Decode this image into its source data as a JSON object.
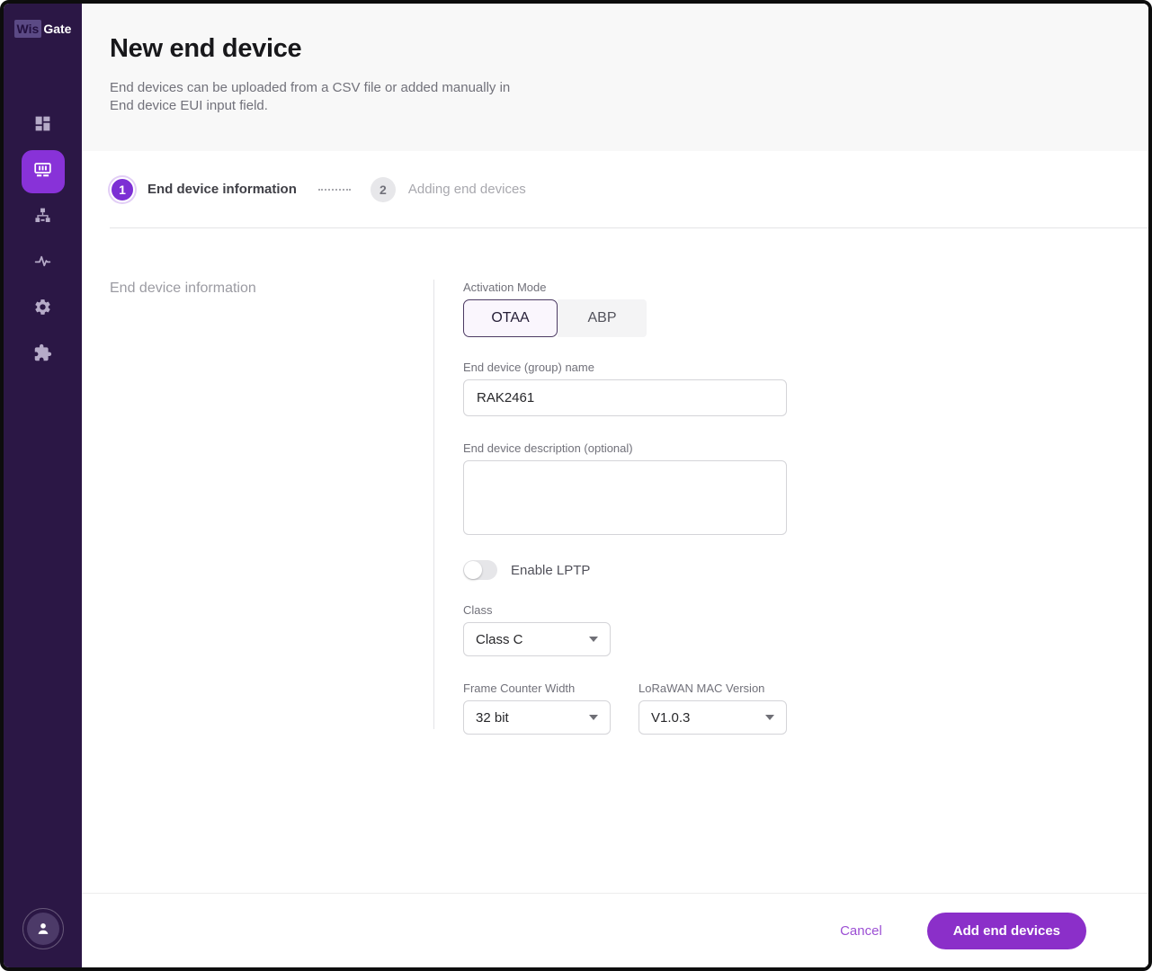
{
  "colors": {
    "sidebar_bg": "#2b1745",
    "active_nav_bg": "#8832d8",
    "header_band_bg": "#f8f8f8",
    "step_active": "#7c2fd4",
    "primary_button": "#8b2fc9",
    "cancel_link": "#9c4fd4",
    "otaa_selected_bg": "#faf6fd",
    "otaa_selected_border": "#4c3a63"
  },
  "sidebar": {
    "logo": {
      "wis": "Wis",
      "gate": "Gate"
    },
    "icons": [
      "dashboard-icon",
      "devices-icon",
      "sitemap-icon",
      "activity-icon",
      "settings-icon",
      "extensions-icon"
    ],
    "active_icon": "devices-icon",
    "avatar": "user-avatar"
  },
  "header": {
    "title": "New end device",
    "description": "End devices can be uploaded from a CSV file or added manually in End device EUI input field."
  },
  "stepper": {
    "steps": [
      {
        "number": "1",
        "label": "End device information",
        "state": "active"
      },
      {
        "number": "2",
        "label": "Adding end devices",
        "state": "inactive"
      }
    ]
  },
  "form": {
    "section_title": "End device information",
    "activation_mode": {
      "label": "Activation Mode",
      "options": [
        "OTAA",
        "ABP"
      ],
      "selected": "OTAA"
    },
    "name": {
      "label": "End device (group) name",
      "value": "RAK2461"
    },
    "description": {
      "label": "End device description (optional)",
      "value": ""
    },
    "lptp": {
      "label": "Enable LPTP",
      "enabled": false
    },
    "class": {
      "label": "Class",
      "value": "Class C"
    },
    "frame_counter": {
      "label": "Frame Counter Width",
      "value": "32 bit"
    },
    "mac_version": {
      "label": "LoRaWAN MAC Version",
      "value": "V1.0.3"
    }
  },
  "footer": {
    "cancel_label": "Cancel",
    "submit_label": "Add end devices"
  }
}
